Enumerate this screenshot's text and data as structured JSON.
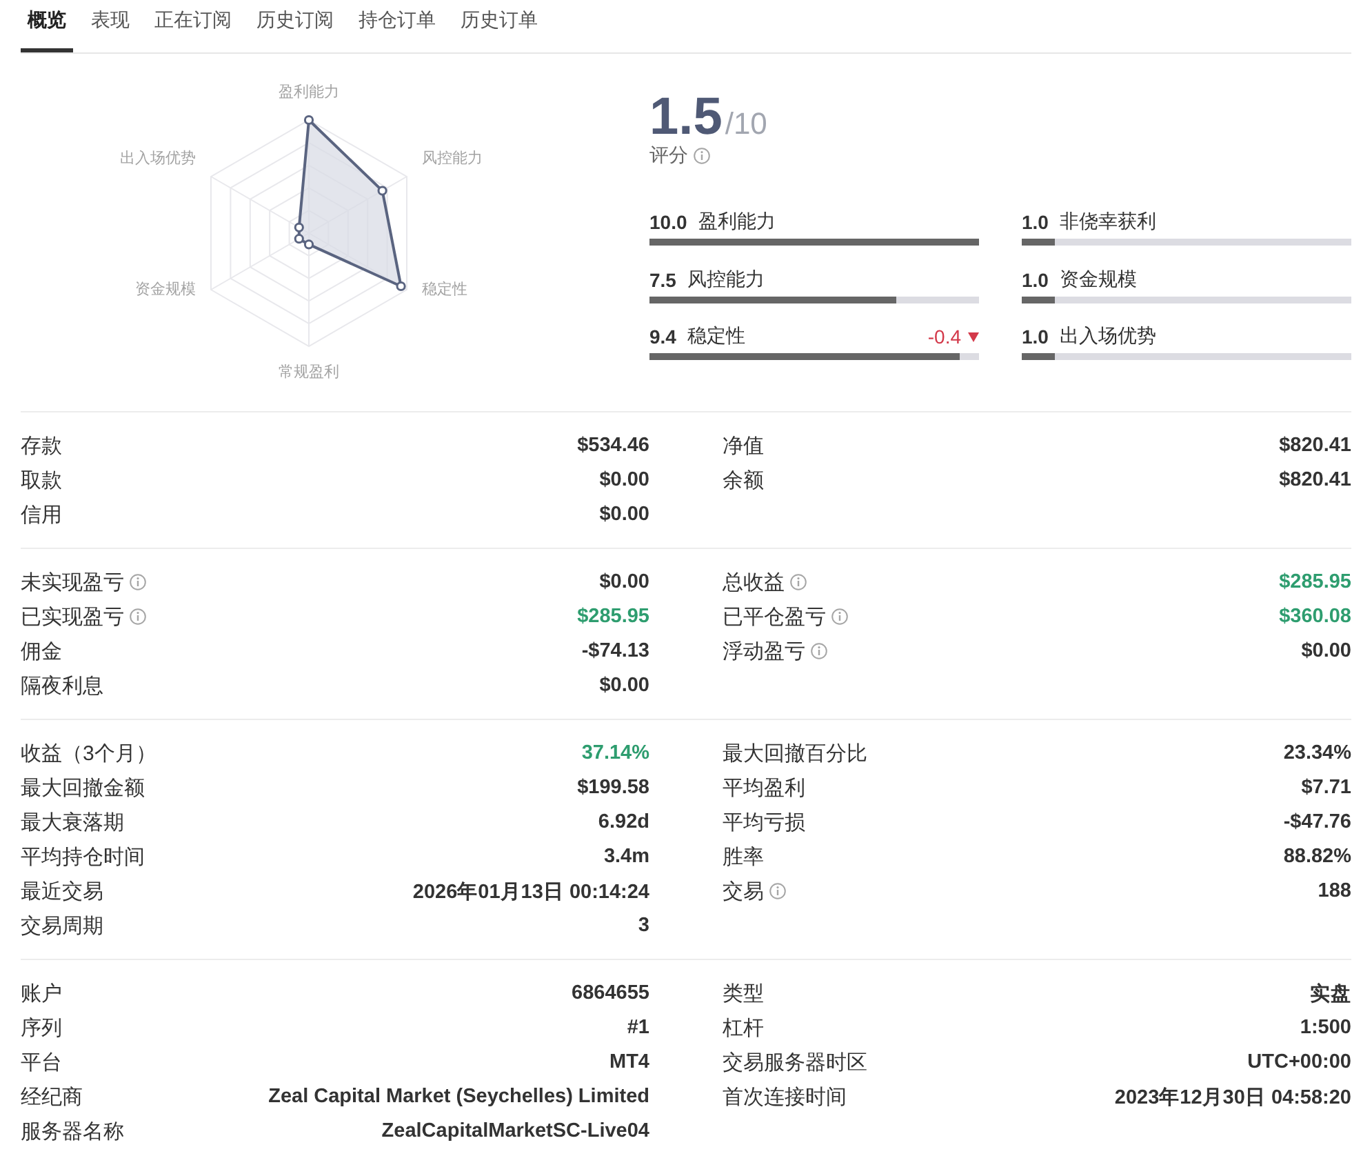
{
  "tabs": [
    {
      "label": "概览",
      "selected": true
    },
    {
      "label": "表现",
      "selected": false
    },
    {
      "label": "正在订阅",
      "selected": false
    },
    {
      "label": "历史订阅",
      "selected": false
    },
    {
      "label": "持仓订单",
      "selected": false
    },
    {
      "label": "历史订单",
      "selected": false
    }
  ],
  "radar": {
    "axes": [
      "盈利能力",
      "风控能力",
      "稳定性",
      "常规盈利",
      "资金规模",
      "出入场优势"
    ]
  },
  "rating": {
    "value": "1.5",
    "scale": "/10",
    "label": "评分",
    "info": true
  },
  "scores": [
    {
      "value": "10.0",
      "name": "盈利能力",
      "level": 1
    },
    {
      "value": "1.0",
      "name": "非侥幸获利",
      "level": 0.1
    },
    {
      "value": "7.5",
      "name": "风控能力",
      "level": 0.75
    },
    {
      "value": "1.0",
      "name": "资金规模",
      "level": 0.1
    },
    {
      "value": "9.4",
      "name": "稳定性",
      "level": 0.94,
      "change": {
        "text": "-0.4",
        "falling": true
      }
    },
    {
      "value": "1.0",
      "name": "出入场优势",
      "level": 0.1
    }
  ],
  "sections": [
    {
      "left": [
        {
          "label": "存款",
          "value": "$534.46",
          "info": false,
          "positive": false
        },
        {
          "label": "取款",
          "value": "$0.00",
          "info": false,
          "positive": false
        },
        {
          "label": "信用",
          "value": "$0.00",
          "info": false,
          "positive": false
        }
      ],
      "right": [
        {
          "label": "净值",
          "value": "$820.41",
          "info": false,
          "positive": false
        },
        {
          "label": "余额",
          "value": "$820.41",
          "info": false,
          "positive": false
        }
      ]
    },
    {
      "left": [
        {
          "label": "未实现盈亏",
          "value": "$0.00",
          "info": true,
          "positive": false
        },
        {
          "label": "已实现盈亏",
          "value": "$285.95",
          "info": true,
          "positive": true
        },
        {
          "label": "佣金",
          "value": "-$74.13",
          "info": false,
          "positive": false
        },
        {
          "label": "隔夜利息",
          "value": "$0.00",
          "info": false,
          "positive": false
        }
      ],
      "right": [
        {
          "label": "总收益",
          "value": "$285.95",
          "info": true,
          "positive": true
        },
        {
          "label": "已平仓盈亏",
          "value": "$360.08",
          "info": true,
          "positive": true
        },
        {
          "label": "浮动盈亏",
          "value": "$0.00",
          "info": true,
          "positive": false
        }
      ]
    },
    {
      "left": [
        {
          "label": "收益（3个月）",
          "value": "37.14%",
          "info": false,
          "positive": true
        },
        {
          "label": "最大回撤金额",
          "value": "$199.58",
          "info": false,
          "positive": false
        },
        {
          "label": "最大衰落期",
          "value": "6.92d",
          "info": false,
          "positive": false
        },
        {
          "label": "平均持仓时间",
          "value": "3.4m",
          "info": false,
          "positive": false
        },
        {
          "label": "最近交易",
          "value": "2026年01月13日 00:14:24",
          "info": false,
          "positive": false
        },
        {
          "label": "交易周期",
          "value": "3",
          "info": false,
          "positive": false
        }
      ],
      "right": [
        {
          "label": "最大回撤百分比",
          "value": "23.34%",
          "info": false,
          "positive": false
        },
        {
          "label": "平均盈利",
          "value": "$7.71",
          "info": false,
          "positive": false
        },
        {
          "label": "平均亏损",
          "value": "-$47.76",
          "info": false,
          "positive": false
        },
        {
          "label": "胜率",
          "value": "88.82%",
          "info": false,
          "positive": false
        },
        {
          "label": "交易",
          "value": "188",
          "info": true,
          "positive": false
        }
      ]
    },
    {
      "left": [
        {
          "label": "账户",
          "value": "6864655",
          "info": false,
          "positive": false
        },
        {
          "label": "序列",
          "value": "#1",
          "info": false,
          "positive": false
        },
        {
          "label": "平台",
          "value": "MT4",
          "info": false,
          "positive": false
        },
        {
          "label": "经纪商",
          "value": "Zeal Capital Market (Seychelles) Limited",
          "info": false,
          "positive": false
        },
        {
          "label": "服务器名称",
          "value": "ZealCapitalMarketSC-Live04",
          "info": false,
          "positive": false
        }
      ],
      "right": [
        {
          "label": "类型",
          "value": "实盘",
          "info": false,
          "positive": false
        },
        {
          "label": "杠杆",
          "value": "1:500",
          "info": false,
          "positive": false
        },
        {
          "label": "交易服务器时区",
          "value": "UTC+00:00",
          "info": false,
          "positive": false
        },
        {
          "label": "首次连接时间",
          "value": "2023年12月30日 04:58:20",
          "info": false,
          "positive": false
        }
      ]
    }
  ]
}
